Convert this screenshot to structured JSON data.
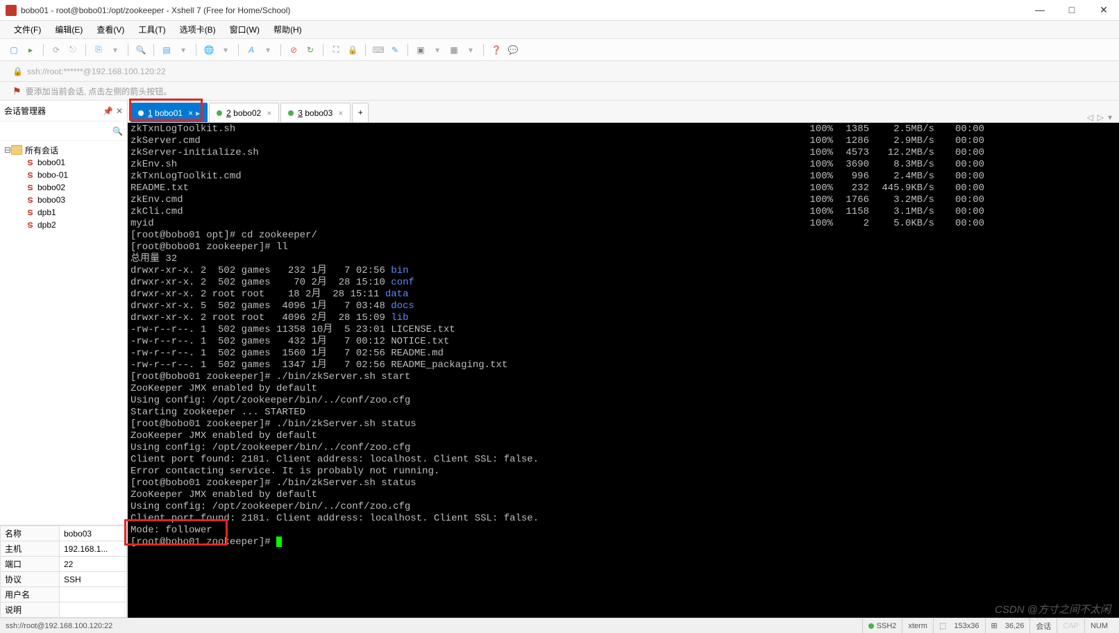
{
  "window": {
    "title": "bobo01 - root@bobo01:/opt/zookeeper - Xshell 7 (Free for Home/School)"
  },
  "menu": {
    "file": "文件(F)",
    "edit": "编辑(E)",
    "view": "查看(V)",
    "tools": "工具(T)",
    "tabs": "选项卡(B)",
    "window": "窗口(W)",
    "help": "帮助(H)"
  },
  "address": {
    "url": "ssh://root:******@192.168.100.120:22"
  },
  "hint": "要添加当前会话, 点击左侧的箭头按钮。",
  "sidebar": {
    "title": "会话管理器",
    "root": "所有会话",
    "items": [
      {
        "label": "bobo01"
      },
      {
        "label": "bobo-01"
      },
      {
        "label": "bobo02"
      },
      {
        "label": "bobo03"
      },
      {
        "label": "dpb1"
      },
      {
        "label": "dpb2"
      }
    ]
  },
  "props": {
    "name_k": "名称",
    "name_v": "bobo03",
    "host_k": "主机",
    "host_v": "192.168.1...",
    "port_k": "端口",
    "port_v": "22",
    "proto_k": "协议",
    "proto_v": "SSH",
    "user_k": "用户名",
    "user_v": "",
    "desc_k": "说明",
    "desc_v": ""
  },
  "tabs": [
    {
      "label": "1 bobo01",
      "active": true
    },
    {
      "label": "2 bobo02",
      "active": false
    },
    {
      "label": "3 bobo03",
      "active": false
    }
  ],
  "term": {
    "files": [
      {
        "name": "zkTxnLogToolkit.sh",
        "pct": "100%",
        "size": "1385",
        "speed": "2.5MB/s",
        "time": "00:00"
      },
      {
        "name": "zkServer.cmd",
        "pct": "100%",
        "size": "1286",
        "speed": "2.9MB/s",
        "time": "00:00"
      },
      {
        "name": "zkServer-initialize.sh",
        "pct": "100%",
        "size": "4573",
        "speed": "12.2MB/s",
        "time": "00:00"
      },
      {
        "name": "zkEnv.sh",
        "pct": "100%",
        "size": "3690",
        "speed": "8.3MB/s",
        "time": "00:00"
      },
      {
        "name": "zkTxnLogToolkit.cmd",
        "pct": "100%",
        "size": "996",
        "speed": "2.4MB/s",
        "time": "00:00"
      },
      {
        "name": "README.txt",
        "pct": "100%",
        "size": "232",
        "speed": "445.9KB/s",
        "time": "00:00"
      },
      {
        "name": "zkEnv.cmd",
        "pct": "100%",
        "size": "1766",
        "speed": "3.2MB/s",
        "time": "00:00"
      },
      {
        "name": "zkCli.cmd",
        "pct": "100%",
        "size": "1158",
        "speed": "3.1MB/s",
        "time": "00:00"
      },
      {
        "name": "myid",
        "pct": "100%",
        "size": "2",
        "speed": "5.0KB/s",
        "time": "00:00"
      }
    ],
    "prompt1": "[root@bobo01 opt]# cd zookeeper/",
    "prompt2": "[root@bobo01 zookeeper]# ll",
    "total": "总用量 32",
    "ll": [
      {
        "line": "drwxr-xr-x. 2  502 games   232 1月   7 02:56 ",
        "name": "bin",
        "cls": "blue"
      },
      {
        "line": "drwxr-xr-x. 2  502 games    70 2月  28 15:10 ",
        "name": "conf",
        "cls": "blue"
      },
      {
        "line": "drwxr-xr-x. 2 root root    18 2月  28 15:11 ",
        "name": "data",
        "cls": "blue"
      },
      {
        "line": "drwxr-xr-x. 5  502 games  4096 1月   7 03:48 ",
        "name": "docs",
        "cls": "blue"
      },
      {
        "line": "drwxr-xr-x. 2 root root   4096 2月  28 15:09 ",
        "name": "lib",
        "cls": "blue"
      },
      {
        "line": "-rw-r--r--. 1  502 games 11358 10月  5 23:01 LICENSE.txt",
        "name": "",
        "cls": ""
      },
      {
        "line": "-rw-r--r--. 1  502 games   432 1月   7 00:12 NOTICE.txt",
        "name": "",
        "cls": ""
      },
      {
        "line": "-rw-r--r--. 1  502 games  1560 1月   7 02:56 README.md",
        "name": "",
        "cls": ""
      },
      {
        "line": "-rw-r--r--. 1  502 games  1347 1月   7 02:56 README_packaging.txt",
        "name": "",
        "cls": ""
      }
    ],
    "out": [
      "[root@bobo01 zookeeper]# ./bin/zkServer.sh start",
      "ZooKeeper JMX enabled by default",
      "Using config: /opt/zookeeper/bin/../conf/zoo.cfg",
      "Starting zookeeper ... STARTED",
      "[root@bobo01 zookeeper]# ./bin/zkServer.sh status",
      "ZooKeeper JMX enabled by default",
      "Using config: /opt/zookeeper/bin/../conf/zoo.cfg",
      "Client port found: 2181. Client address: localhost. Client SSL: false.",
      "Error contacting service. It is probably not running.",
      "[root@bobo01 zookeeper]# ./bin/zkServer.sh status",
      "ZooKeeper JMX enabled by default",
      "Using config: /opt/zookeeper/bin/../conf/zoo.cfg",
      "Client port found: 2181. Client address: localhost. Client SSL: false.",
      "Mode: follower"
    ],
    "prompt3": "[root@bobo01 zookeeper]# "
  },
  "status": {
    "left": "ssh://root@192.168.100.120:22",
    "ssh": "SSH2",
    "term": "xterm",
    "dim": "153x36",
    "pos": "36,26",
    "sess": "会话",
    "cap": "CAP",
    "num": "NUM"
  },
  "watermark": "CSDN @方寸之间不太闲"
}
